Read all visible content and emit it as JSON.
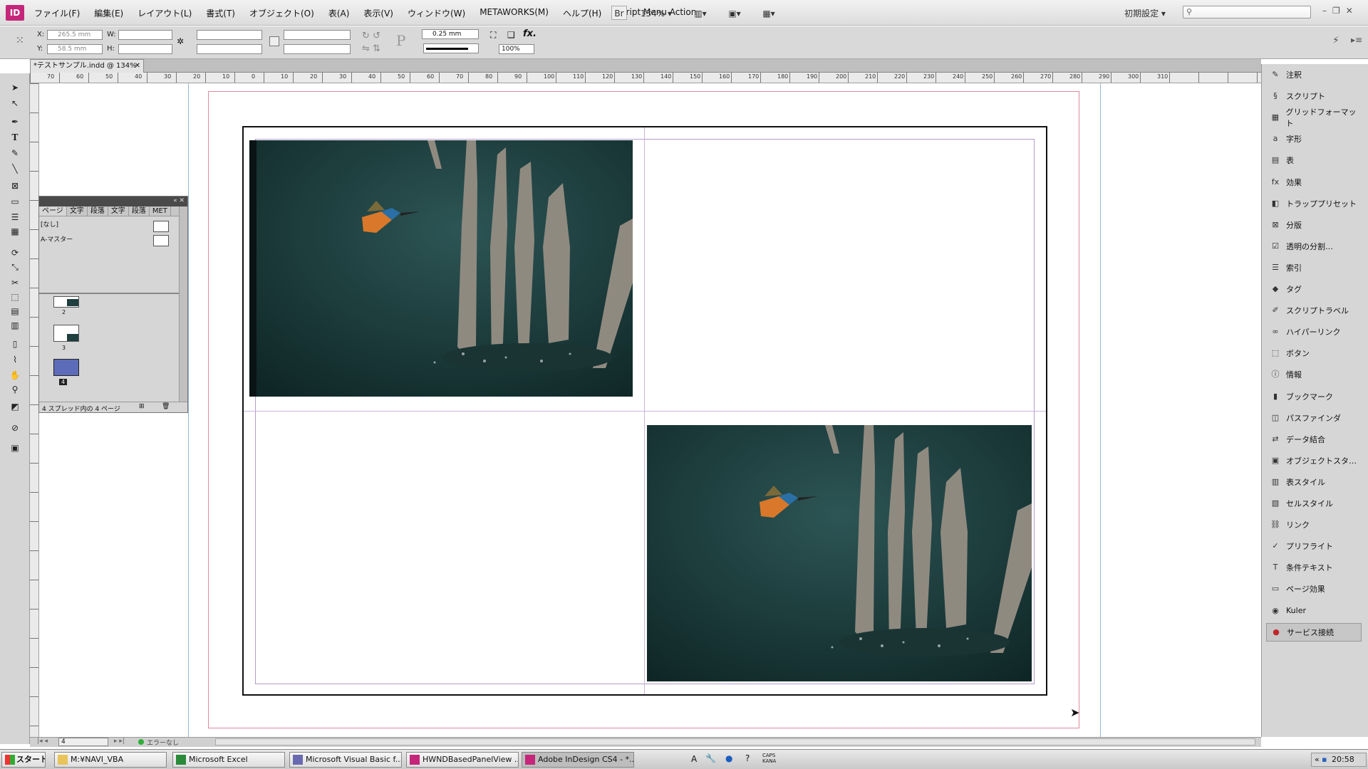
{
  "app": {
    "logo": "ID",
    "accent": "#c5267a"
  },
  "menu": {
    "items": [
      "ファイル(F)",
      "編集(E)",
      "レイアウト(L)",
      "書式(T)",
      "オブジェクト(O)",
      "表(A)",
      "表示(V)",
      "ウィンドウ(W)",
      "METAWORKS(M)",
      "ヘルプ(H)",
      "Script Menu Action"
    ],
    "bridge": "Br",
    "zoom": "134%",
    "workspace": "初期設定"
  },
  "control": {
    "x_label": "X:",
    "y_label": "Y:",
    "w_label": "W:",
    "h_label": "H:",
    "x_value": "265.5 mm",
    "y_value": "58.5 mm",
    "stroke_weight": "0.25 mm",
    "opacity": "100%"
  },
  "document": {
    "tab_title": "*テストサンプル.indd @ 134%"
  },
  "ruler": {
    "ticks": [
      "70",
      "60",
      "50",
      "40",
      "30",
      "20",
      "10",
      "0",
      "10",
      "20",
      "30",
      "40",
      "50",
      "60",
      "70",
      "80",
      "90",
      "100",
      "110",
      "120",
      "130",
      "140",
      "150",
      "160",
      "170",
      "180",
      "190",
      "200",
      "210",
      "220",
      "230",
      "240",
      "250",
      "260",
      "270",
      "280",
      "290",
      "300",
      "310"
    ]
  },
  "pages_panel": {
    "tabs": [
      "ページ",
      "文字",
      "段落",
      "文字",
      "段落",
      "MET"
    ],
    "masters": [
      "[なし]",
      "A-マスター"
    ],
    "page_numbers": [
      "2",
      "3",
      "4"
    ],
    "status": "4 スプレッド内の 4 ページ"
  },
  "right_panel": {
    "items": [
      {
        "label": "注釈",
        "icon": "note-icon"
      },
      {
        "label": "スクリプト",
        "icon": "script-icon"
      },
      {
        "label": "グリッドフォーマット",
        "icon": "grid-icon"
      },
      {
        "label": "字形",
        "icon": "glyph-icon"
      },
      {
        "label": "表",
        "icon": "table-icon"
      },
      {
        "label": "効果",
        "icon": "fx-icon"
      },
      {
        "label": "トラッププリセット",
        "icon": "trap-icon"
      },
      {
        "label": "分版",
        "icon": "separations-icon"
      },
      {
        "label": "透明の分割…",
        "icon": "flattener-icon"
      },
      {
        "label": "索引",
        "icon": "index-icon"
      },
      {
        "label": "タグ",
        "icon": "tag-icon"
      },
      {
        "label": "スクリプトラベル",
        "icon": "script-label-icon"
      },
      {
        "label": "ハイパーリンク",
        "icon": "hyperlink-icon"
      },
      {
        "label": "ボタン",
        "icon": "button-icon"
      },
      {
        "label": "情報",
        "icon": "info-icon"
      },
      {
        "label": "ブックマーク",
        "icon": "bookmark-icon"
      },
      {
        "label": "パスファインダ",
        "icon": "pathfinder-icon"
      },
      {
        "label": "データ結合",
        "icon": "data-merge-icon"
      },
      {
        "label": "オブジェクトスタ…",
        "icon": "object-style-icon"
      },
      {
        "label": "表スタイル",
        "icon": "table-style-icon"
      },
      {
        "label": "セルスタイル",
        "icon": "cell-style-icon"
      },
      {
        "label": "リンク",
        "icon": "links-icon"
      },
      {
        "label": "プリフライト",
        "icon": "preflight-icon"
      },
      {
        "label": "条件テキスト",
        "icon": "conditional-text-icon"
      },
      {
        "label": "ページ効果",
        "icon": "page-transition-icon"
      },
      {
        "label": "Kuler",
        "icon": "kuler-icon"
      },
      {
        "label": "サービス接続",
        "icon": "service-icon"
      }
    ]
  },
  "statusbar": {
    "page": "4",
    "errors": "エラーなし"
  },
  "taskbar": {
    "start": "スタート",
    "tasks": [
      "M:¥NAVI_VBA",
      "Microsoft Excel",
      "Microsoft Visual Basic f...",
      "HWNDBasedPanelView ...",
      "Adobe InDesign CS4 - *..."
    ],
    "ime": "A",
    "caps": "CAPS",
    "kana": "KANA",
    "time": "20:58"
  }
}
